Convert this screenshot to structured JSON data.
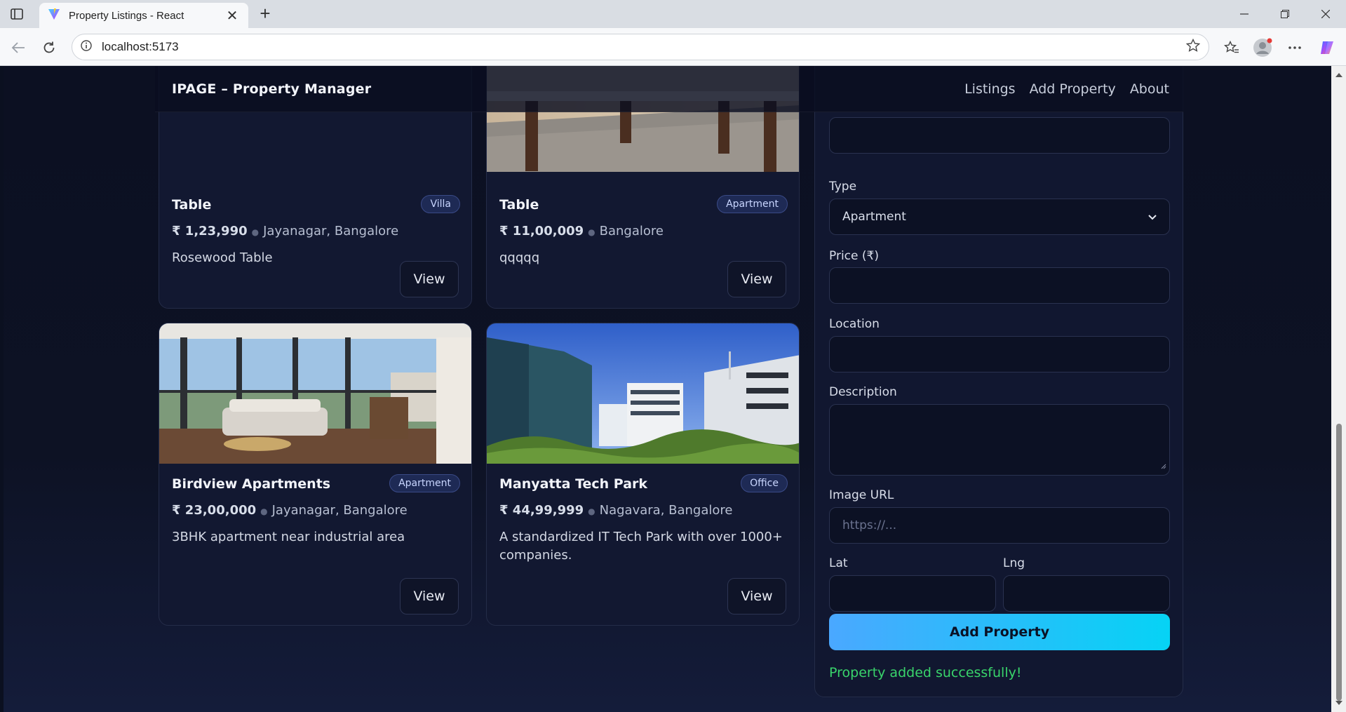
{
  "browser": {
    "tab_title": "Property Listings - React",
    "url": "localhost:5173",
    "new_tab_symbol": "+",
    "close_symbol": "✕"
  },
  "header": {
    "brand": "IPAGE – Property Manager",
    "nav": [
      "Listings",
      "Add Property",
      "About"
    ]
  },
  "listings": [
    {
      "title": "Table",
      "type": "Villa",
      "price": "₹ 1,23,990",
      "location": "Jayanagar, Bangalore",
      "description": "Rosewood Table",
      "view_label": "View"
    },
    {
      "title": "Table",
      "type": "Apartment",
      "price": "₹ 11,00,009",
      "location": "Bangalore",
      "description": "qqqqq",
      "view_label": "View"
    },
    {
      "title": "Birdview Apartments",
      "type": "Apartment",
      "price": "₹ 23,00,000",
      "location": "Jayanagar, Bangalore",
      "description": "3BHK apartment near industrial area",
      "view_label": "View"
    },
    {
      "title": "Manyatta Tech Park",
      "type": "Office",
      "price": "₹ 44,99,999",
      "location": "Nagavara, Bangalore",
      "description": "A standardized IT Tech Park with over 1000+ companies.",
      "view_label": "View"
    }
  ],
  "form": {
    "type_label": "Type",
    "type_value": "Apartment",
    "price_label": "Price (₹)",
    "location_label": "Location",
    "description_label": "Description",
    "image_label": "Image URL",
    "image_placeholder": "https://...",
    "lat_label": "Lat",
    "lng_label": "Lng",
    "submit_label": "Add Property",
    "success_message": "Property added successfully!"
  },
  "colors": {
    "accent_start": "#4aa8ff",
    "accent_end": "#06d3f5",
    "success": "#39d46b",
    "badge_bg": "#1e2a55"
  }
}
